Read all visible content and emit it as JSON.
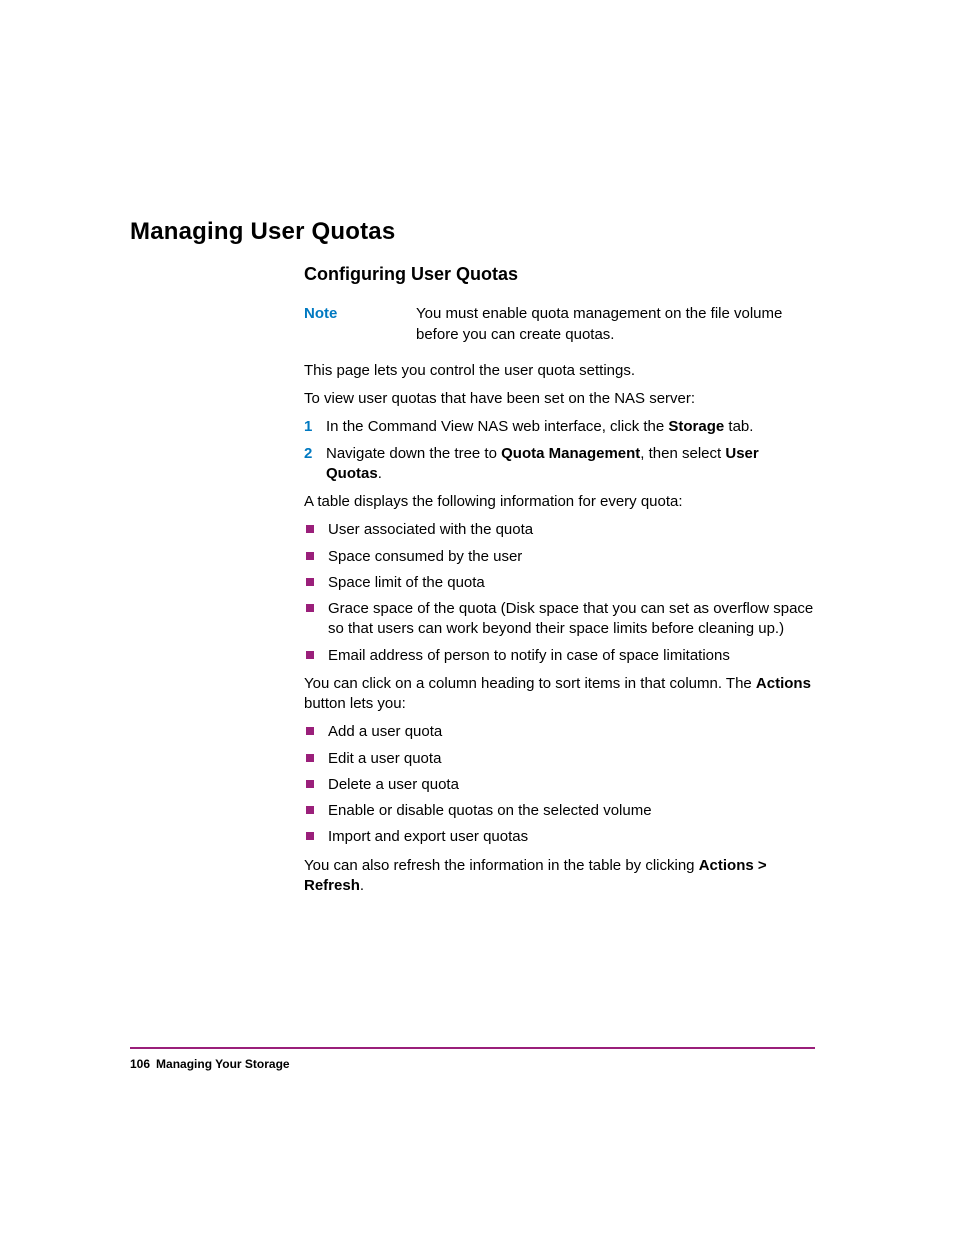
{
  "h1": "Managing User Quotas",
  "h2": "Configuring User Quotas",
  "note": {
    "label": "Note",
    "text": "You must enable quota management on the file volume before you can create quotas."
  },
  "p1": "This page lets you control the user quota settings.",
  "p2": "To view user quotas that have been set on the NAS server:",
  "steps": [
    {
      "num": "1",
      "pre": "In the Command View NAS web interface, click the ",
      "b": "Storage",
      "post": " tab."
    },
    {
      "num": "2",
      "pre": "Navigate down the tree to ",
      "b": "Quota Management",
      "mid": ", then select ",
      "b2": "User Quotas",
      "post": "."
    }
  ],
  "p3": "A table displays the following information for every quota:",
  "bullets1": [
    "User associated with the quota",
    "Space consumed by the user",
    "Space limit of the quota",
    "Grace space of the quota (Disk space that you can set as overflow space so that users can work beyond their space limits before cleaning up.)",
    "Email address of person to notify in case of space limitations"
  ],
  "p4": {
    "pre": "You can click on a column heading to sort items in that column. The ",
    "b": "Actions",
    "post": " button lets you:"
  },
  "bullets2": [
    "Add a user quota",
    "Edit a user quota",
    "Delete a user quota",
    "Enable or disable quotas on the selected volume",
    "Import and export user quotas"
  ],
  "p5": {
    "pre": "You can also refresh the information in the table by clicking ",
    "b": "Actions > Refresh",
    "post": "."
  },
  "footer": {
    "page": "106",
    "title": "Managing Your Storage"
  }
}
